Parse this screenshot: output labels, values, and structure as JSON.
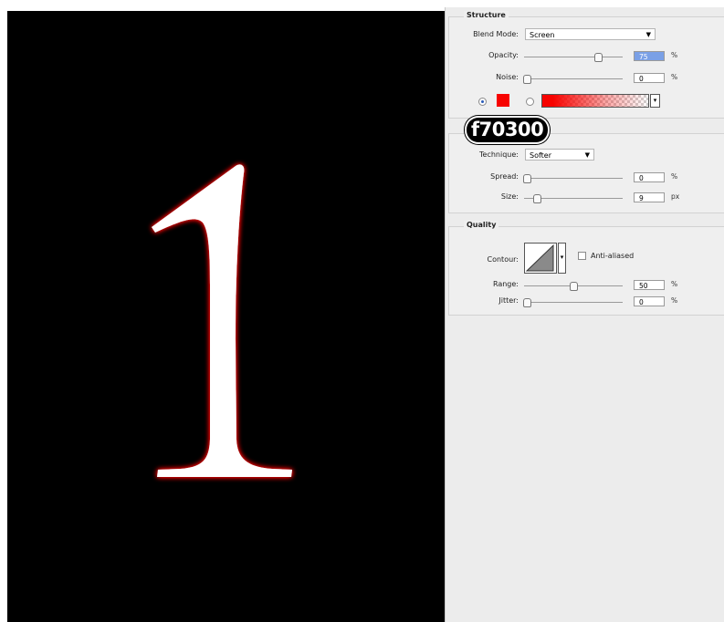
{
  "canvas": {
    "glyph": "1",
    "background_color": "#000000",
    "glyph_color": "#ffffff",
    "glow_color": "#f70300"
  },
  "annotation": {
    "text": "f70300"
  },
  "structure": {
    "title": "Structure",
    "blend_mode": {
      "label": "Blend Mode:",
      "value": "Screen"
    },
    "opacity": {
      "label": "Opacity:",
      "value": "75",
      "unit": "%",
      "level": 0.75
    },
    "noise": {
      "label": "Noise:",
      "value": "0",
      "unit": "%",
      "level": 0
    },
    "color_swatch": "#f70300",
    "gradient_start": "#f70300"
  },
  "elements": {
    "technique": {
      "label": "Technique:",
      "value": "Softer"
    },
    "spread": {
      "label": "Spread:",
      "value": "0",
      "unit": "%",
      "level": 0
    },
    "size": {
      "label": "Size:",
      "value": "9",
      "unit": "px",
      "level": 0.1
    }
  },
  "quality": {
    "title": "Quality",
    "contour": {
      "label": "Contour:"
    },
    "anti_aliased": {
      "label": "Anti-aliased",
      "checked": false
    },
    "range": {
      "label": "Range:",
      "value": "50",
      "unit": "%",
      "level": 0.5
    },
    "jitter": {
      "label": "Jitter:",
      "value": "0",
      "unit": "%",
      "level": 0
    }
  }
}
